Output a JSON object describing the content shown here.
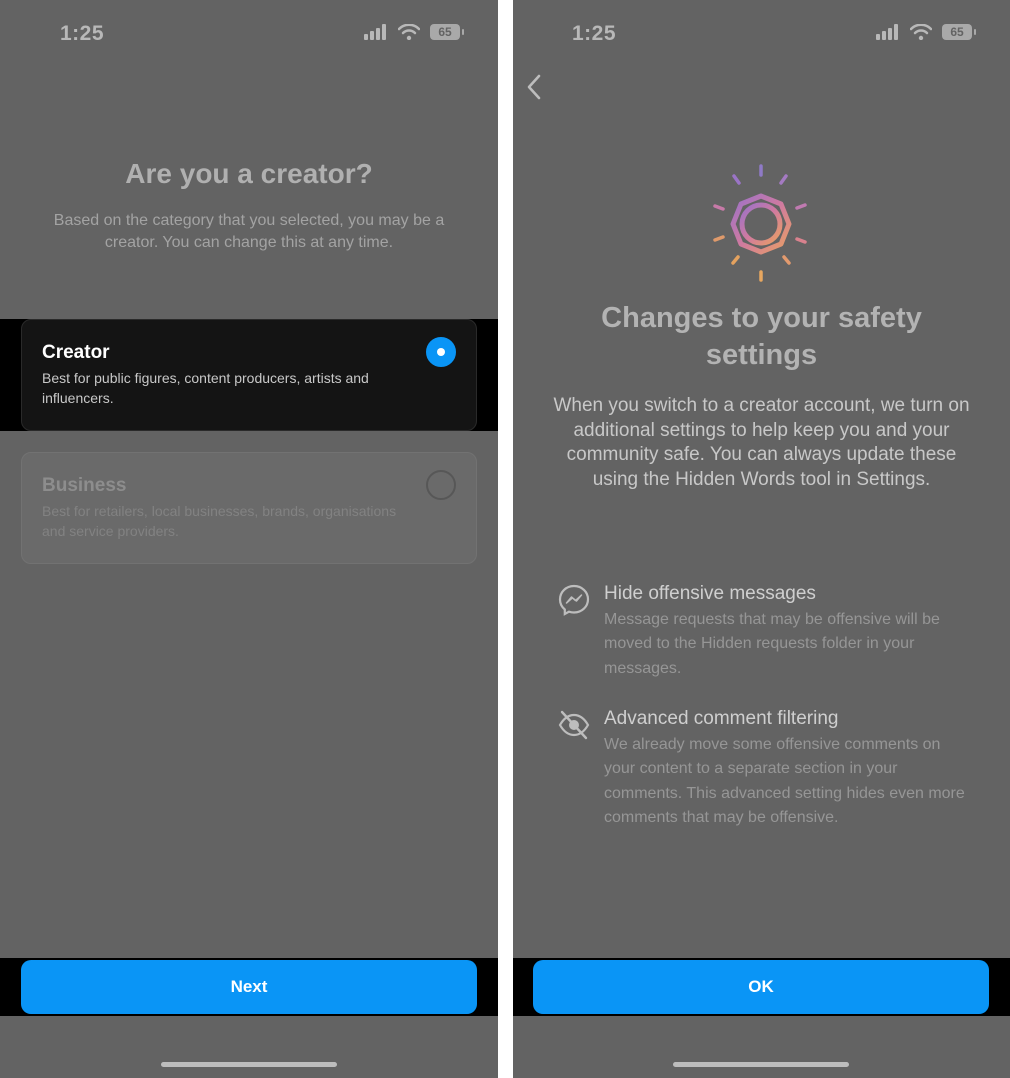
{
  "left_screen": {
    "status_time": "1:25",
    "battery": "65",
    "title": "Are you a creator?",
    "subtitle": "Based on the category that you selected, you may be a creator. You can change this at any time.",
    "options": [
      {
        "title": "Creator",
        "description": "Best for public figures, content producers, artists and influencers.",
        "selected": true
      },
      {
        "title": "Business",
        "description": "Best for retailers, local businesses, brands, organisations and service providers.",
        "selected": false
      }
    ],
    "next_label": "Next"
  },
  "right_screen": {
    "status_time": "1:25",
    "battery": "65",
    "title": "Changes to your safety settings",
    "body": "When you switch to a creator account, we turn on additional settings to help keep you and your community safe. You can always update these using the Hidden Words tool in Settings.",
    "settings": [
      {
        "icon": "messenger-icon",
        "title": "Hide offensive messages",
        "description": "Message requests that may be offensive will be moved to the Hidden requests folder in your messages."
      },
      {
        "icon": "eye-slash-icon",
        "title": "Advanced comment filtering",
        "description": "We already move some offensive comments on your content to a separate section in your comments. This advanced setting hides even more comments that may be offensive."
      }
    ],
    "ok_label": "OK"
  },
  "colors": {
    "accent": "#0a95f6",
    "overlay": "#636363",
    "card_selected": "#141414"
  }
}
